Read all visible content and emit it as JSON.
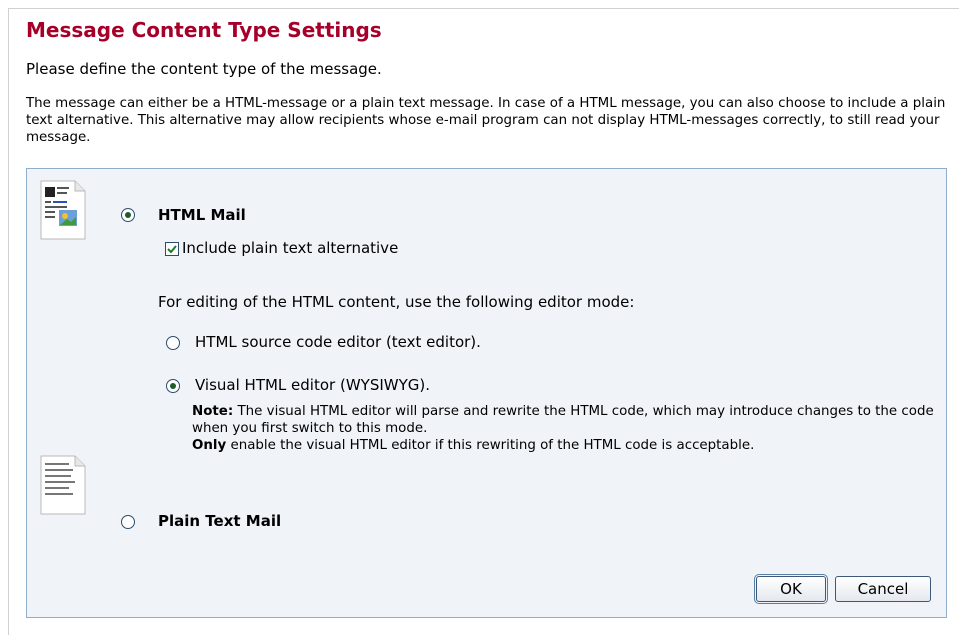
{
  "dialog": {
    "title": "Message Content Type Settings",
    "intro": "Please define the content type of the message.",
    "description": "The message can either be a HTML-message or a plain text message. In case of a HTML message, you can also choose to include a plain text alternative. This alternative may allow recipients whose e-mail program can not display HTML-messages correctly, to still read your message."
  },
  "html_mail": {
    "label": "HTML Mail",
    "selected": true,
    "include_plain_text_alternative": {
      "label": "Include plain text alternative",
      "checked": true
    },
    "editor_mode_prompt": "For editing of the HTML content, use the following editor mode:",
    "editor_modes": [
      {
        "label": "HTML source code editor (text editor).",
        "selected": false
      },
      {
        "label": "Visual HTML editor (WYSIWYG).",
        "selected": true
      }
    ],
    "note": {
      "note_label": "Note:",
      "note_text": " The visual HTML editor will parse and rewrite the HTML code, which may introduce changes to the code when you first switch to this mode.",
      "only_label": "Only",
      "only_text": " enable the visual HTML editor if this rewriting of the HTML code is acceptable."
    },
    "icon": "html-document-icon"
  },
  "plain_text_mail": {
    "label": "Plain Text Mail",
    "selected": false,
    "icon": "plain-text-document-icon"
  },
  "buttons": {
    "ok": "OK",
    "cancel": "Cancel"
  },
  "colors": {
    "title": "#a6002a",
    "panel_background": "#f0f4f9",
    "panel_border": "#8eaecb"
  }
}
